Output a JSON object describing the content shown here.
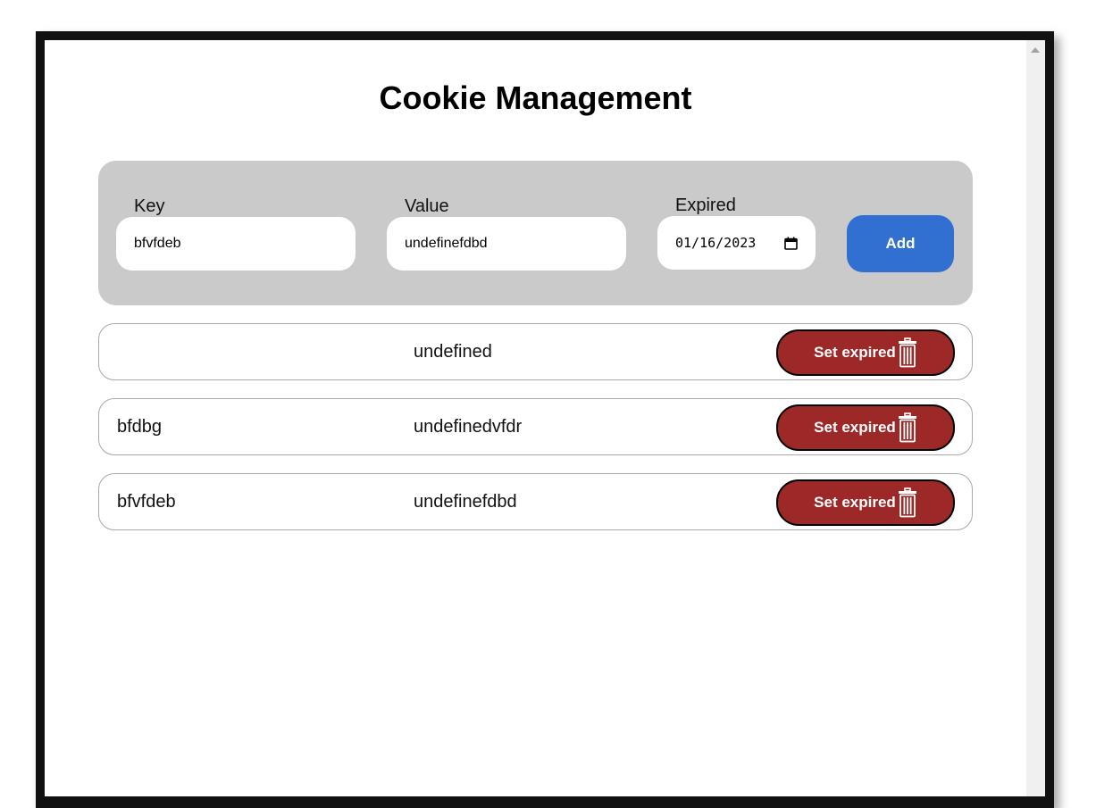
{
  "page": {
    "title": "Cookie Management"
  },
  "form": {
    "key_label": "Key",
    "key_value": "bfvfdeb",
    "value_label": "Value",
    "value_value": "undefinefdbd",
    "expired_label": "Expired",
    "expired_value": "01/16/2023",
    "add_label": "Add"
  },
  "cookies": [
    {
      "key": "",
      "value": "undefined",
      "action_label": "Set expired"
    },
    {
      "key": "bfdbg",
      "value": "undefinedvfdr",
      "action_label": "Set expired"
    },
    {
      "key": "bfvfdeb",
      "value": "undefinefdbd",
      "action_label": "Set expired"
    }
  ],
  "icons": {
    "calendar": "calendar-icon",
    "trash": "trash-icon"
  },
  "colors": {
    "add_button": "#3170d0",
    "expire_button": "#9c2828",
    "form_panel": "#cacaca"
  }
}
